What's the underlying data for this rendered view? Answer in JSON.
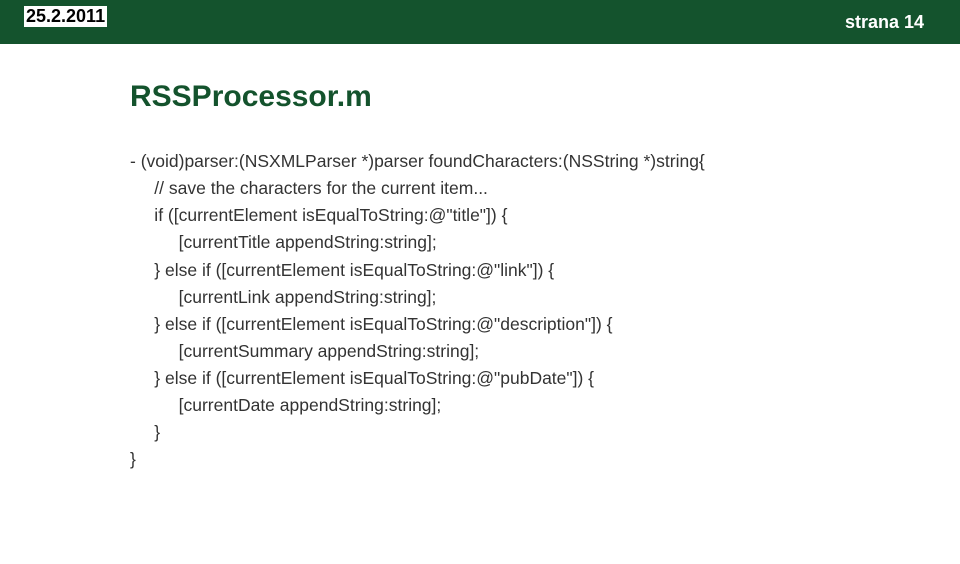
{
  "header": {
    "date": "25.2.2011",
    "page": "strana 14"
  },
  "title": "RSSProcessor.m",
  "code": "- (void)parser:(NSXMLParser *)parser foundCharacters:(NSString *)string{\n     // save the characters for the current item...\n     if ([currentElement isEqualToString:@\"title\"]) {\n          [currentTitle appendString:string];\n     } else if ([currentElement isEqualToString:@\"link\"]) {\n          [currentLink appendString:string];\n     } else if ([currentElement isEqualToString:@\"description\"]) {\n          [currentSummary appendString:string];\n     } else if ([currentElement isEqualToString:@\"pubDate\"]) {\n          [currentDate appendString:string];\n     }\n}"
}
